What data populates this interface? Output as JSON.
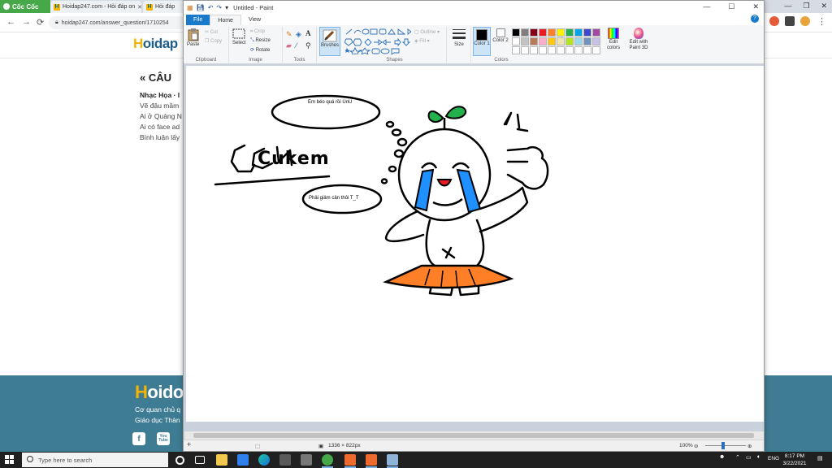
{
  "browser": {
    "brand": "Cốc Cốc",
    "tabs": [
      {
        "label": "Hoidap247.com - Hỏi đáp on"
      },
      {
        "label": "Hỏi đáp"
      }
    ],
    "url": "hoidap247.com/answer_question/1710254",
    "window_controls": {
      "minimize": "—",
      "maximize": "❐",
      "close": "✕"
    }
  },
  "site": {
    "logo_h": "H",
    "logo_rest": "oidap",
    "question_heading": "« CÂU",
    "lines": [
      "Nhạc Họa · l",
      "Vẽ đậu mầm",
      "Ai ở Quảng N",
      "Ai có face ad",
      "Bình luận lấy"
    ],
    "footer": {
      "logo_h": "H",
      "logo_rest": "oido",
      "lines": [
        "Cơ quan chủ q",
        "Giáo dục Thàn"
      ],
      "social": [
        "f",
        "You Tube"
      ]
    }
  },
  "paint": {
    "title": "Untitled - Paint",
    "window_controls": {
      "minimize": "—",
      "maximize": "☐",
      "close": "✕"
    },
    "tabs": {
      "file": "File",
      "home": "Home",
      "view": "View"
    },
    "ribbon": {
      "clipboard": {
        "paste": "Paste",
        "cut": "Cut",
        "copy": "Copy",
        "label": "Clipboard"
      },
      "image": {
        "select": "Select",
        "crop": "Crop",
        "resize": "Resize",
        "rotate": "Rotate",
        "label": "Image"
      },
      "tools": {
        "label": "Tools"
      },
      "brushes": {
        "label": "Brushes"
      },
      "shapes": {
        "outline": "Outline",
        "fill": "Fill",
        "label": "Shapes"
      },
      "size": {
        "label": "Size"
      },
      "colors": {
        "color1": "Color 1",
        "color2": "Color 2",
        "edit_colors": "Edit colors",
        "edit_paint3d": "Edit with Paint 3D",
        "label": "Colors",
        "palette": [
          "#000000",
          "#7f7f7f",
          "#880015",
          "#ed1c24",
          "#ff7f27",
          "#fff200",
          "#22b14c",
          "#00a2e8",
          "#3f48cc",
          "#a349a4",
          "#ffffff",
          "#c3c3c3",
          "#b97a57",
          "#ffaec9",
          "#ffc90e",
          "#efe4b0",
          "#b5e61d",
          "#99d9ea",
          "#7092be",
          "#c8bfe7",
          "#ffffff",
          "#ffffff",
          "#ffffff",
          "#ffffff",
          "#ffffff",
          "#ffffff",
          "#ffffff",
          "#ffffff",
          "#ffffff",
          "#ffffff"
        ]
      }
    },
    "canvas": {
      "bubble_top": "Em béo quá rồi UnU",
      "bubble_bottom": "Phải giảm cân thôi T_T",
      "signature": "Cukem"
    },
    "status": {
      "dimensions": "1336 × 822px",
      "zoom": "100%"
    }
  },
  "taskbar": {
    "search_placeholder": "Type here to search",
    "language": "ENG",
    "time": "8:17 PM",
    "date": "3/22/2021"
  }
}
